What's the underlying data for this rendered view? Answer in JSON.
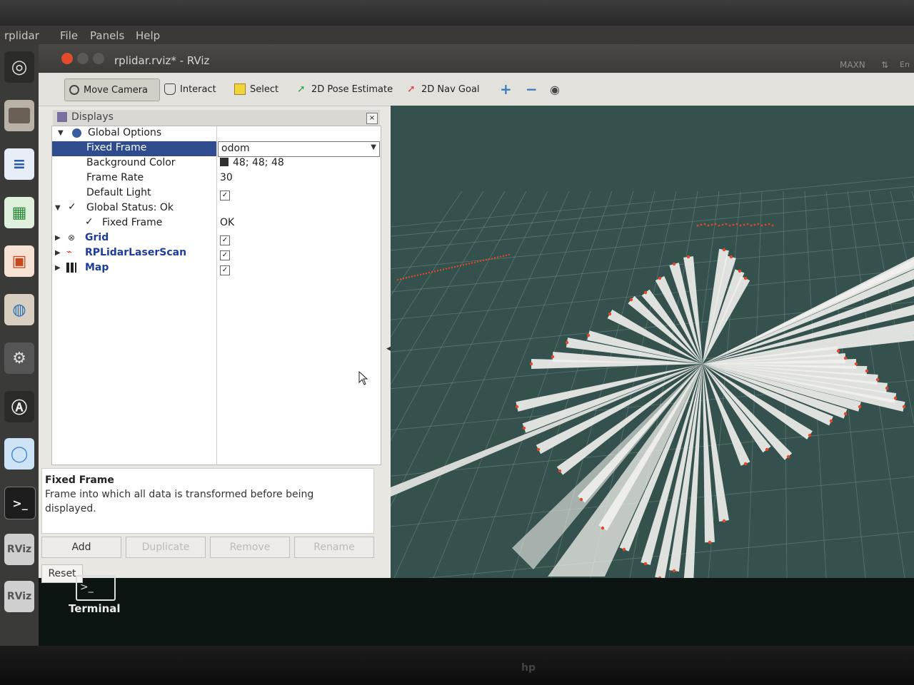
{
  "system_menu": {
    "app_name": "rplidar",
    "file": "File",
    "panels": "Panels",
    "help": "Help",
    "tray_mode": "MAXN",
    "tray_lang": "En"
  },
  "window": {
    "title": "rplidar.rviz* - RViz"
  },
  "toolbar": {
    "move_camera": "Move Camera",
    "interact": "Interact",
    "select": "Select",
    "pose_estimate": "2D Pose Estimate",
    "nav_goal": "2D Nav Goal",
    "add_tool": "+",
    "remove_tool": "−"
  },
  "displays": {
    "title": "Displays",
    "close": "×",
    "rows": [
      {
        "name": "Global Options"
      },
      {
        "name": "Fixed Frame",
        "value": "odom"
      },
      {
        "name": "Background Color",
        "value": "48; 48; 48"
      },
      {
        "name": "Frame Rate",
        "value": "30"
      },
      {
        "name": "Default Light",
        "value": "✓"
      },
      {
        "name": "Global Status: Ok"
      },
      {
        "name": "Fixed Frame",
        "value": "OK"
      },
      {
        "name": "Grid",
        "value": "✓"
      },
      {
        "name": "RPLidarLaserScan",
        "value": "✓"
      },
      {
        "name": "Map",
        "value": "✓"
      }
    ],
    "description_title": "Fixed Frame",
    "description_body": "Frame into which all data is transformed before being displayed.",
    "buttons": {
      "add": "Add",
      "duplicate": "Duplicate",
      "remove": "Remove",
      "rename": "Rename",
      "reset": "Reset"
    }
  },
  "desktop": {
    "terminal_label": "Terminal"
  },
  "colors": {
    "view_background": "#35514d",
    "grid": "#6f8d88",
    "scan_free": "#f2f1ee",
    "scan_hits": "#e0482a",
    "selected_row": "#2f4c8e"
  },
  "icons": [
    "ubuntu-icon",
    "files-icon",
    "writer-icon",
    "calc-icon",
    "impress-icon",
    "software-icon",
    "settings-icon",
    "updater-icon",
    "chromium-icon",
    "terminal-icon",
    "rviz-icon"
  ]
}
